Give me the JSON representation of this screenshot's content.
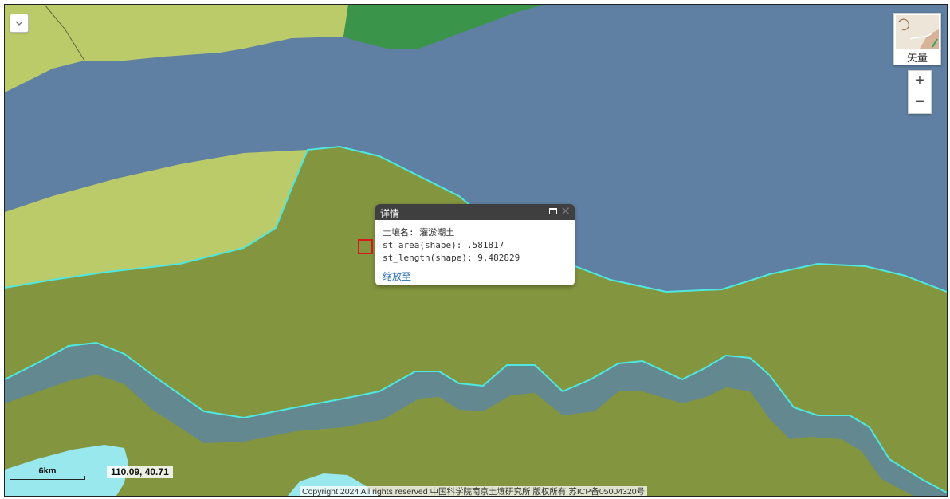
{
  "colors": {
    "river": "#5f80a2",
    "soil_olive": "#84953f",
    "soil_light": "#bccb6a",
    "forest": "#3a944a",
    "lake": "#98e8ee",
    "boundary": "#4ee8e0",
    "selection_marker": "#d41c1c"
  },
  "map_controls": {
    "toggle_icon": "chevron-down-icon",
    "basemap_label": "矢量",
    "zoom_in_label": "+",
    "zoom_out_label": "−"
  },
  "popup": {
    "title": "详情",
    "maximize_icon": "maximize-icon",
    "close_icon": "close-icon",
    "close_label": "✕",
    "fields": [
      {
        "label": "土壤名",
        "separator": ": ",
        "value": "灌淤潮土"
      },
      {
        "label": "st_area(shape)",
        "separator": ": ",
        "value": ".581817"
      },
      {
        "label": "st_length(shape)",
        "separator": ": ",
        "value": "9.482829"
      }
    ],
    "zoom_link": "缩放至"
  },
  "scale_bar": {
    "label": "6km"
  },
  "coordinates": {
    "text": "110.09, 40.71"
  },
  "copyright": {
    "text": "Copyright 2024 All rights reserved 中国科学院南京土壤研究所 版权所有 苏ICP备05004320号"
  }
}
